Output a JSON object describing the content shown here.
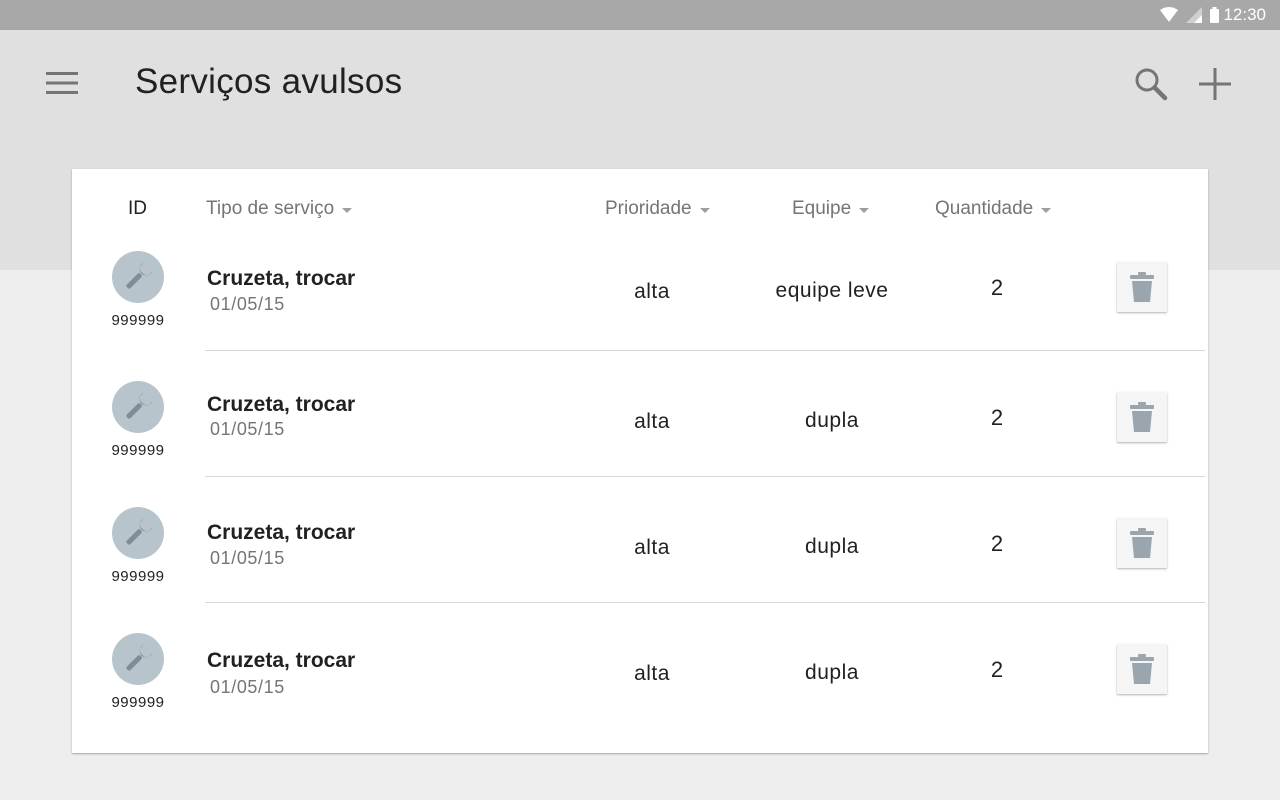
{
  "status_bar": {
    "time": "12:30",
    "icons": [
      "wifi-icon",
      "signal-icon",
      "battery-icon"
    ]
  },
  "app_bar": {
    "title": "Serviços avulsos",
    "menu_icon": "menu-icon",
    "search_icon": "search-icon",
    "add_icon": "add-icon"
  },
  "table": {
    "headers": {
      "id": "ID",
      "tipo": "Tipo de serviço",
      "prioridade": "Prioridade",
      "equipe": "Equipe",
      "quantidade": "Quantidade"
    },
    "rows": [
      {
        "id": "999999",
        "title": "Cruzeta, trocar",
        "date": "01/05/15",
        "prioridade": "alta",
        "equipe": "equipe leve",
        "quantidade": "2"
      },
      {
        "id": "999999",
        "title": "Cruzeta, trocar",
        "date": "01/05/15",
        "prioridade": "alta",
        "equipe": "dupla",
        "quantidade": "2"
      },
      {
        "id": "999999",
        "title": "Cruzeta, trocar",
        "date": "01/05/15",
        "prioridade": "alta",
        "equipe": "dupla",
        "quantidade": "2"
      },
      {
        "id": "999999",
        "title": "Cruzeta, trocar",
        "date": "01/05/15",
        "prioridade": "alta",
        "equipe": "dupla",
        "quantidade": "2"
      }
    ]
  },
  "colors": {
    "status_bar": "#a8a8a8",
    "app_bar": "#e0e0e0",
    "background": "#eeeeee",
    "card": "#ffffff",
    "avatar": "#b8c4cc",
    "icon_gray": "#7f8d96"
  }
}
